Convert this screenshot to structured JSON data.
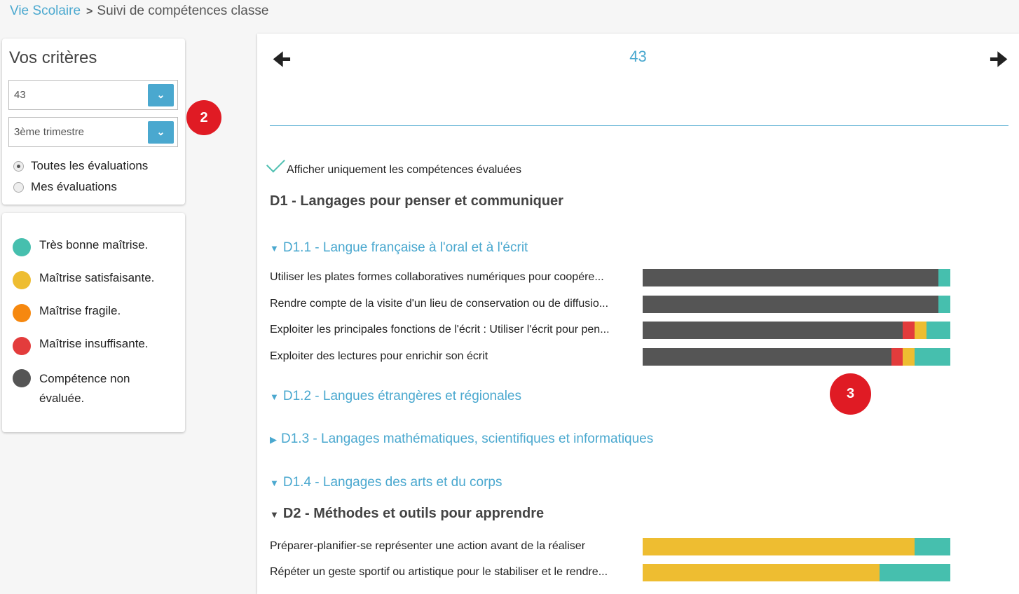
{
  "breadcrumb": {
    "root": "Vie Scolaire",
    "current": "Suivi de compétences classe"
  },
  "criteria": {
    "title": "Vos critères",
    "class_value": "43",
    "period_value": "3ème trimestre",
    "radios": [
      {
        "label": "Toutes les évaluations",
        "checked": true
      },
      {
        "label": "Mes évaluations",
        "checked": false
      }
    ]
  },
  "badges": [
    "2",
    "3"
  ],
  "legend": [
    {
      "label": "Très bonne maîtrise.",
      "color": "#46bfae"
    },
    {
      "label": "Maîtrise satisfaisante.",
      "color": "#eebd31"
    },
    {
      "label": "Maîtrise fragile.",
      "color": "#f6880f"
    },
    {
      "label": "Maîtrise insuffisante.",
      "color": "#e33c3c"
    },
    {
      "label": "Compétence non évaluée.",
      "color": "#555555"
    }
  ],
  "main": {
    "class_title": "43",
    "filter_label": "Afficher uniquement les compétences évaluées",
    "d1": "D1 - Langages pour penser et communiquer",
    "d1_1": "D1.1 - Langue française à l'oral et à l'écrit",
    "d1_2": "D1.2 - Langues étrangères et régionales",
    "d1_3": "D1.3 - Langages mathématiques, scientifiques et informatiques",
    "d1_4": "D1.4 - Langages des arts et du corps",
    "d2": "D2 - Méthodes et outils pour apprendre",
    "rows_d1_1": [
      {
        "label": "Utiliser les plates formes collaboratives numériques pour coopére...",
        "counts": {
          "non": 25,
          "insuf": 0,
          "fragile": 0,
          "satis": 0,
          "tres": 1
        }
      },
      {
        "label": "Rendre compte de la visite d'un lieu de conservation ou de diffusio...",
        "counts": {
          "non": 25,
          "insuf": 0,
          "fragile": 0,
          "satis": 0,
          "tres": 1
        }
      },
      {
        "label": "Exploiter les principales fonctions de l'écrit : Utiliser l'écrit pour pen...",
        "counts": {
          "non": 22,
          "insuf": 1,
          "fragile": 0,
          "satis": 1,
          "tres": 2
        }
      },
      {
        "label": "Exploiter des lectures pour enrichir son écrit",
        "counts": {
          "non": 21,
          "insuf": 1,
          "fragile": 0,
          "satis": 1,
          "tres": 3
        }
      }
    ],
    "rows_d2": [
      {
        "label": "Préparer-planifier-se représenter une action avant de la réaliser",
        "counts": {
          "non": 0,
          "insuf": 0,
          "fragile": 0,
          "satis": 23,
          "tres": 3
        }
      },
      {
        "label": "Répéter un geste sportif ou artistique pour le stabiliser et le rendre...",
        "counts": {
          "non": 0,
          "insuf": 0,
          "fragile": 0,
          "satis": 20,
          "tres": 6
        }
      }
    ]
  }
}
